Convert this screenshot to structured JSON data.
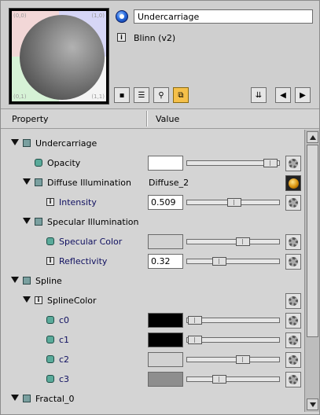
{
  "material": {
    "name": "Undercarriage",
    "shader": "Blinn (v2)"
  },
  "swatch": {
    "corner_labels": {
      "tl": "(0,0)",
      "tr": "(1,0)",
      "bl": "(0,1)",
      "br": "(1,1)"
    }
  },
  "toolbar": {
    "icons": [
      "render-options-icon",
      "list-icon",
      "pin-icon",
      "material-view-icon",
      "collapse-icon",
      "back-icon",
      "forward-icon"
    ]
  },
  "header": {
    "property": "Property",
    "value": "Value"
  },
  "rows": {
    "undercarriage": "Undercarriage",
    "opacity": "Opacity",
    "diffuse_illumination": "Diffuse Illumination",
    "diffuse_value": "Diffuse_2",
    "intensity": "Intensity",
    "intensity_value": "0.509",
    "specular_illumination": "Specular Illumination",
    "specular_color": "Specular Color",
    "reflectivity": "Reflectivity",
    "reflectivity_value": "0.32",
    "spline": "Spline",
    "spline_color": "SplineColor",
    "c0": "c0",
    "c1": "c1",
    "c2": "c2",
    "c3": "c3",
    "fractal": "Fractal_0"
  },
  "values": {
    "opacity_slider": 0.95,
    "intensity_slider": 0.509,
    "specular_slider": 0.62,
    "reflectivity_slider": 0.32,
    "c0_slider": 0.0,
    "c1_slider": 0.0,
    "c2_slider": 0.62,
    "c3_slider": 0.32
  },
  "colors": {
    "opacity_swatch": "#ffffff",
    "specular_swatch": "#d2d2d2",
    "c0": "#000000",
    "c1": "#000000",
    "c2": "#d2d2d2",
    "c3": "#8e8e8e"
  }
}
